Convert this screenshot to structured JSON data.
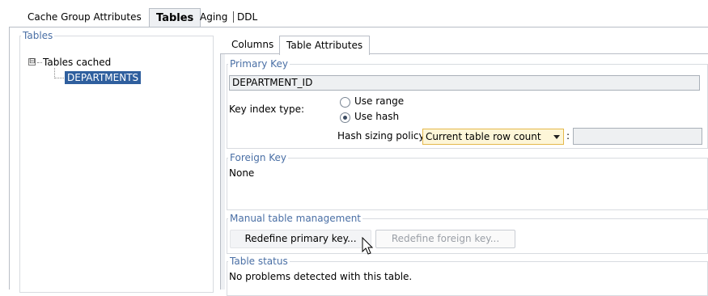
{
  "top_tabs": [
    {
      "label": "Cache Group Attributes",
      "active": false
    },
    {
      "label": "Tables",
      "active": true
    },
    {
      "label": "Aging",
      "active": false
    },
    {
      "label": "DDL",
      "active": false
    }
  ],
  "tables_panel": {
    "legend": "Tables",
    "tree": {
      "root_label": "Tables cached",
      "expander": "⊟",
      "children": [
        "DEPARTMENTS"
      ]
    }
  },
  "inner_tabs": [
    {
      "label": "Columns",
      "active": false
    },
    {
      "label": "Table Attributes",
      "active": true
    }
  ],
  "primary_key": {
    "legend": "Primary Key",
    "value": "DEPARTMENT_ID",
    "key_index_label": "Key index type:",
    "options": [
      {
        "label": "Use range",
        "selected": false
      },
      {
        "label": "Use hash",
        "selected": true
      }
    ],
    "hash_policy_label": "Hash sizing policy",
    "hash_policy_value": "Current table row count",
    "hash_policy_colon": ":",
    "hash_policy_extra": ""
  },
  "foreign_key": {
    "legend": "Foreign Key",
    "value": "None"
  },
  "manual_mgmt": {
    "legend": "Manual table management",
    "redefine_primary": "Redefine primary key...",
    "redefine_foreign": "Redefine foreign key..."
  },
  "table_status": {
    "legend": "Table status",
    "message": "No problems detected with this table."
  },
  "colors": {
    "selection": "#2f5f9e",
    "legend_text": "#4a6fa5",
    "dropdown_bg": "#fdf6d8"
  }
}
